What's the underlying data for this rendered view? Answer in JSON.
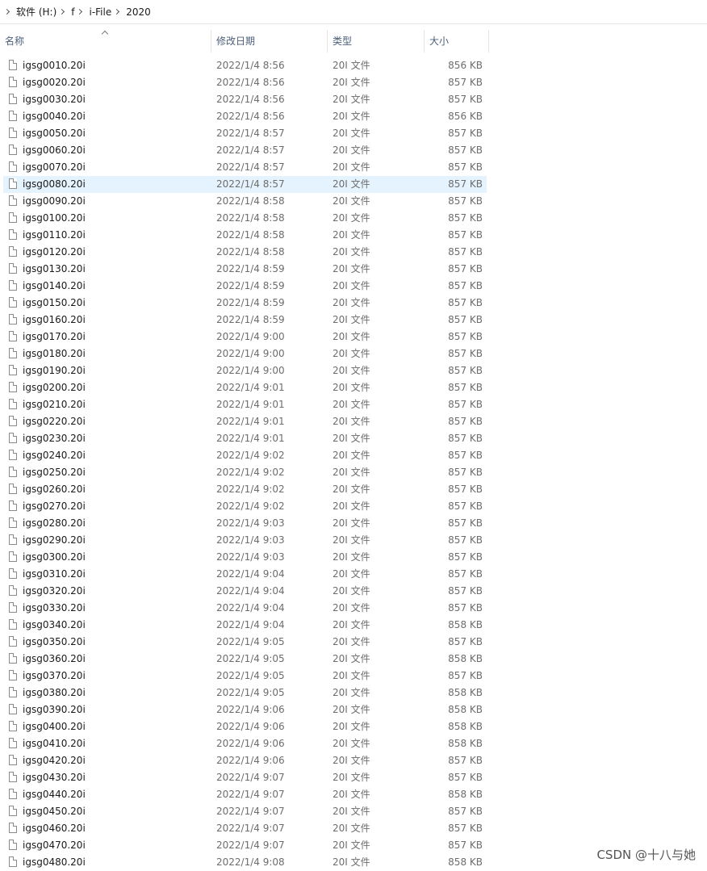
{
  "breadcrumb": [
    "软件 (H:)",
    "f",
    "i-File",
    "2020"
  ],
  "columns": {
    "name": "名称",
    "date": "修改日期",
    "type": "类型",
    "size": "大小"
  },
  "selected_row": 7,
  "files": [
    {
      "name": "igsg0010.20i",
      "date": "2022/1/4 8:56",
      "type": "20I 文件",
      "size": "856 KB"
    },
    {
      "name": "igsg0020.20i",
      "date": "2022/1/4 8:56",
      "type": "20I 文件",
      "size": "857 KB"
    },
    {
      "name": "igsg0030.20i",
      "date": "2022/1/4 8:56",
      "type": "20I 文件",
      "size": "857 KB"
    },
    {
      "name": "igsg0040.20i",
      "date": "2022/1/4 8:56",
      "type": "20I 文件",
      "size": "856 KB"
    },
    {
      "name": "igsg0050.20i",
      "date": "2022/1/4 8:57",
      "type": "20I 文件",
      "size": "857 KB"
    },
    {
      "name": "igsg0060.20i",
      "date": "2022/1/4 8:57",
      "type": "20I 文件",
      "size": "857 KB"
    },
    {
      "name": "igsg0070.20i",
      "date": "2022/1/4 8:57",
      "type": "20I 文件",
      "size": "857 KB"
    },
    {
      "name": "igsg0080.20i",
      "date": "2022/1/4 8:57",
      "type": "20I 文件",
      "size": "857 KB"
    },
    {
      "name": "igsg0090.20i",
      "date": "2022/1/4 8:58",
      "type": "20I 文件",
      "size": "857 KB"
    },
    {
      "name": "igsg0100.20i",
      "date": "2022/1/4 8:58",
      "type": "20I 文件",
      "size": "857 KB"
    },
    {
      "name": "igsg0110.20i",
      "date": "2022/1/4 8:58",
      "type": "20I 文件",
      "size": "857 KB"
    },
    {
      "name": "igsg0120.20i",
      "date": "2022/1/4 8:58",
      "type": "20I 文件",
      "size": "857 KB"
    },
    {
      "name": "igsg0130.20i",
      "date": "2022/1/4 8:59",
      "type": "20I 文件",
      "size": "857 KB"
    },
    {
      "name": "igsg0140.20i",
      "date": "2022/1/4 8:59",
      "type": "20I 文件",
      "size": "857 KB"
    },
    {
      "name": "igsg0150.20i",
      "date": "2022/1/4 8:59",
      "type": "20I 文件",
      "size": "857 KB"
    },
    {
      "name": "igsg0160.20i",
      "date": "2022/1/4 8:59",
      "type": "20I 文件",
      "size": "857 KB"
    },
    {
      "name": "igsg0170.20i",
      "date": "2022/1/4 9:00",
      "type": "20I 文件",
      "size": "857 KB"
    },
    {
      "name": "igsg0180.20i",
      "date": "2022/1/4 9:00",
      "type": "20I 文件",
      "size": "857 KB"
    },
    {
      "name": "igsg0190.20i",
      "date": "2022/1/4 9:00",
      "type": "20I 文件",
      "size": "857 KB"
    },
    {
      "name": "igsg0200.20i",
      "date": "2022/1/4 9:01",
      "type": "20I 文件",
      "size": "857 KB"
    },
    {
      "name": "igsg0210.20i",
      "date": "2022/1/4 9:01",
      "type": "20I 文件",
      "size": "857 KB"
    },
    {
      "name": "igsg0220.20i",
      "date": "2022/1/4 9:01",
      "type": "20I 文件",
      "size": "857 KB"
    },
    {
      "name": "igsg0230.20i",
      "date": "2022/1/4 9:01",
      "type": "20I 文件",
      "size": "857 KB"
    },
    {
      "name": "igsg0240.20i",
      "date": "2022/1/4 9:02",
      "type": "20I 文件",
      "size": "857 KB"
    },
    {
      "name": "igsg0250.20i",
      "date": "2022/1/4 9:02",
      "type": "20I 文件",
      "size": "857 KB"
    },
    {
      "name": "igsg0260.20i",
      "date": "2022/1/4 9:02",
      "type": "20I 文件",
      "size": "857 KB"
    },
    {
      "name": "igsg0270.20i",
      "date": "2022/1/4 9:02",
      "type": "20I 文件",
      "size": "857 KB"
    },
    {
      "name": "igsg0280.20i",
      "date": "2022/1/4 9:03",
      "type": "20I 文件",
      "size": "857 KB"
    },
    {
      "name": "igsg0290.20i",
      "date": "2022/1/4 9:03",
      "type": "20I 文件",
      "size": "857 KB"
    },
    {
      "name": "igsg0300.20i",
      "date": "2022/1/4 9:03",
      "type": "20I 文件",
      "size": "857 KB"
    },
    {
      "name": "igsg0310.20i",
      "date": "2022/1/4 9:04",
      "type": "20I 文件",
      "size": "857 KB"
    },
    {
      "name": "igsg0320.20i",
      "date": "2022/1/4 9:04",
      "type": "20I 文件",
      "size": "857 KB"
    },
    {
      "name": "igsg0330.20i",
      "date": "2022/1/4 9:04",
      "type": "20I 文件",
      "size": "857 KB"
    },
    {
      "name": "igsg0340.20i",
      "date": "2022/1/4 9:04",
      "type": "20I 文件",
      "size": "858 KB"
    },
    {
      "name": "igsg0350.20i",
      "date": "2022/1/4 9:05",
      "type": "20I 文件",
      "size": "857 KB"
    },
    {
      "name": "igsg0360.20i",
      "date": "2022/1/4 9:05",
      "type": "20I 文件",
      "size": "858 KB"
    },
    {
      "name": "igsg0370.20i",
      "date": "2022/1/4 9:05",
      "type": "20I 文件",
      "size": "857 KB"
    },
    {
      "name": "igsg0380.20i",
      "date": "2022/1/4 9:05",
      "type": "20I 文件",
      "size": "858 KB"
    },
    {
      "name": "igsg0390.20i",
      "date": "2022/1/4 9:06",
      "type": "20I 文件",
      "size": "858 KB"
    },
    {
      "name": "igsg0400.20i",
      "date": "2022/1/4 9:06",
      "type": "20I 文件",
      "size": "858 KB"
    },
    {
      "name": "igsg0410.20i",
      "date": "2022/1/4 9:06",
      "type": "20I 文件",
      "size": "858 KB"
    },
    {
      "name": "igsg0420.20i",
      "date": "2022/1/4 9:06",
      "type": "20I 文件",
      "size": "857 KB"
    },
    {
      "name": "igsg0430.20i",
      "date": "2022/1/4 9:07",
      "type": "20I 文件",
      "size": "857 KB"
    },
    {
      "name": "igsg0440.20i",
      "date": "2022/1/4 9:07",
      "type": "20I 文件",
      "size": "858 KB"
    },
    {
      "name": "igsg0450.20i",
      "date": "2022/1/4 9:07",
      "type": "20I 文件",
      "size": "857 KB"
    },
    {
      "name": "igsg0460.20i",
      "date": "2022/1/4 9:07",
      "type": "20I 文件",
      "size": "857 KB"
    },
    {
      "name": "igsg0470.20i",
      "date": "2022/1/4 9:07",
      "type": "20I 文件",
      "size": "857 KB"
    },
    {
      "name": "igsg0480.20i",
      "date": "2022/1/4 9:08",
      "type": "20I 文件",
      "size": "858 KB"
    }
  ],
  "icons": {
    "file": "file-icon",
    "separator": "chevron-right-icon",
    "sort": "sort-ascending-icon"
  },
  "watermark": "CSDN @十八与她"
}
